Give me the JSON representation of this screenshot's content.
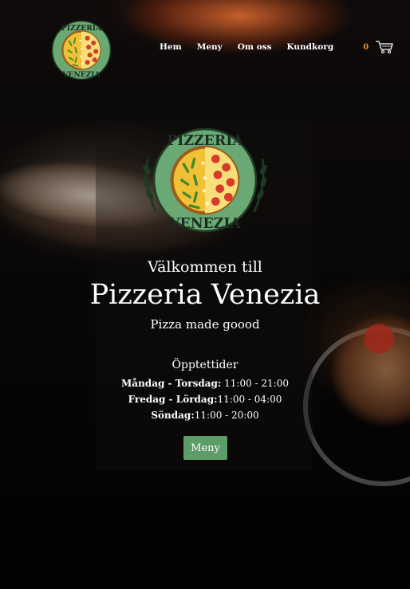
{
  "brand": {
    "logo_text_top": "PIZZERIA",
    "logo_text_bottom": "VENEZIA"
  },
  "nav": {
    "items": [
      {
        "label": "Hem"
      },
      {
        "label": "Meny"
      },
      {
        "label": "Om oss"
      },
      {
        "label": "Kundkorg"
      }
    ],
    "cart_count": "0",
    "cart_icon": "shopping-cart-icon"
  },
  "hero": {
    "welcome": "Välkommen till",
    "name": "Pizzeria Venezia",
    "tagline": "Pizza made goood",
    "hours_title": "Öpptettider",
    "hours": [
      {
        "days": "Måndag - Torsdag:",
        "time": " 11:00 - 21:00"
      },
      {
        "days": "Fredag - Lördag:",
        "time": "11:00 - 04:00"
      },
      {
        "days": "Söndag:",
        "time": "11:00 - 20:00"
      }
    ],
    "cta_label": "Meny"
  },
  "colors": {
    "accent": "#5b9c67",
    "cart_count": "#e9902f",
    "logo_ring": "#6aa874"
  }
}
